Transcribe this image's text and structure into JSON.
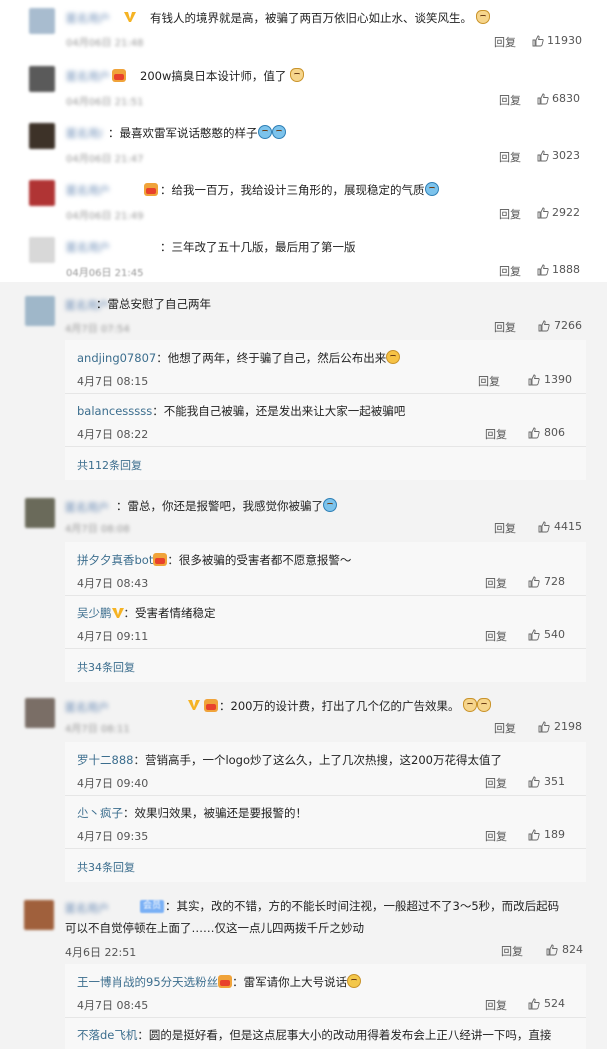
{
  "actions": {
    "reply_label": "回复"
  },
  "top_comments": [
    {
      "text": "有钱人的境界就是高，被骗了两百万依旧心如止水、谈笑风生。",
      "date": "04月06日 21:48",
      "likes": "11930",
      "name": "匿名用户",
      "avatar_color": "#a8bccf",
      "emojis": [
        "cat"
      ],
      "vip": true,
      "crown": false
    },
    {
      "text": "200w搞臭日本设计师，值了",
      "date": "04月06日 21:51",
      "likes": "6830",
      "name": "匿名用户",
      "avatar_color": "#5a5a5a",
      "emojis": [
        "cat"
      ],
      "vip": false,
      "crown": true
    },
    {
      "text": "最喜欢雷军说话憨憨的样子",
      "date": "04月06日 21:47",
      "likes": "3023",
      "name": "匿名用户",
      "avatar_color": "#3d3228",
      "emojis": [
        "cry",
        "cry"
      ],
      "vip": false,
      "crown": false
    },
    {
      "text": "给我一百万，我给设计三角形的，展现稳定的气质",
      "date": "04月06日 21:49",
      "likes": "2922",
      "name": "匿名用户",
      "avatar_color": "#b03434",
      "emojis": [
        "cry"
      ],
      "vip": false,
      "crown": true
    },
    {
      "text": "三年改了五十几版，最后用了第一版",
      "date": "04月06日 21:45",
      "likes": "1888",
      "name": "匿名用户",
      "avatar_color": "#d8d8d8",
      "emojis": [],
      "vip": false,
      "crown": false
    }
  ],
  "main_comments": [
    {
      "text": "雷总安慰了自己两年",
      "date": "4月7日 07:54",
      "likes": "7266",
      "name": "匿名用户",
      "avatar_color": "#9fb7c9",
      "replies": [
        {
          "user": "andjing07807",
          "text": "他想了两年，终于骗了自己，然后公布出来",
          "date": "4月7日 08:15",
          "likes": "1390"
        },
        {
          "user": "balancesssss",
          "text": "不能我自己被骗，还是发出来让大家一起被骗吧",
          "date": "4月7日 08:22",
          "likes": "806"
        }
      ],
      "more": "共112条回复"
    },
    {
      "text": "雷总，你还是报警吧，我感觉你被骗了",
      "date": "4月7日 08:08",
      "likes": "4415",
      "name": "匿名用户",
      "avatar_color": "#6a6a5a",
      "replies": [
        {
          "user": "拼夕夕真香bot",
          "text": "很多被骗的受害者都不愿意报警～",
          "date": "4月7日 08:43",
          "likes": "728"
        },
        {
          "user": "吴少鹏",
          "text": "受害者情绪稳定",
          "date": "4月7日 09:11",
          "likes": "540"
        }
      ],
      "more": "共34条回复"
    },
    {
      "text": "200万的设计费，打出了几个亿的广告效果。",
      "date": "4月7日 08:11",
      "likes": "2198",
      "name": "匿名用户",
      "avatar_color": "#7a6e66",
      "replies": [
        {
          "user": "罗十二888",
          "text": "营销高手，一个logo炒了这么久，上了几次热搜，这200万花得太值了",
          "date": "4月7日 09:40",
          "likes": "351"
        },
        {
          "user": "尐丶疯子",
          "text": "效果归效果，被骗还是要报警的！",
          "date": "4月7日 09:35",
          "likes": "189"
        }
      ],
      "more": "共34条回复"
    },
    {
      "text_line1": "其实，改的不错，方的不能长时间注视，一般超过不了3～5秒，而改后起码",
      "text_line2": "可以不自觉停顿在上面了……仅这一点儿四两拨千斤之妙动",
      "date": "4月6日 22:51",
      "likes": "824",
      "name": "匿名用户",
      "avatar_color": "#a0603c",
      "member_tag": "会员",
      "replies": [
        {
          "user": "王一博肖战的95分天选粉丝",
          "text": "雷军请你上大号说话",
          "date": "4月7日 08:45",
          "likes": "524"
        },
        {
          "user": "不落de飞机",
          "text": "圆的是挺好看，但是这点屁事大小的改动用得着发布会上正八经讲一下吗，直接"
        }
      ]
    }
  ]
}
